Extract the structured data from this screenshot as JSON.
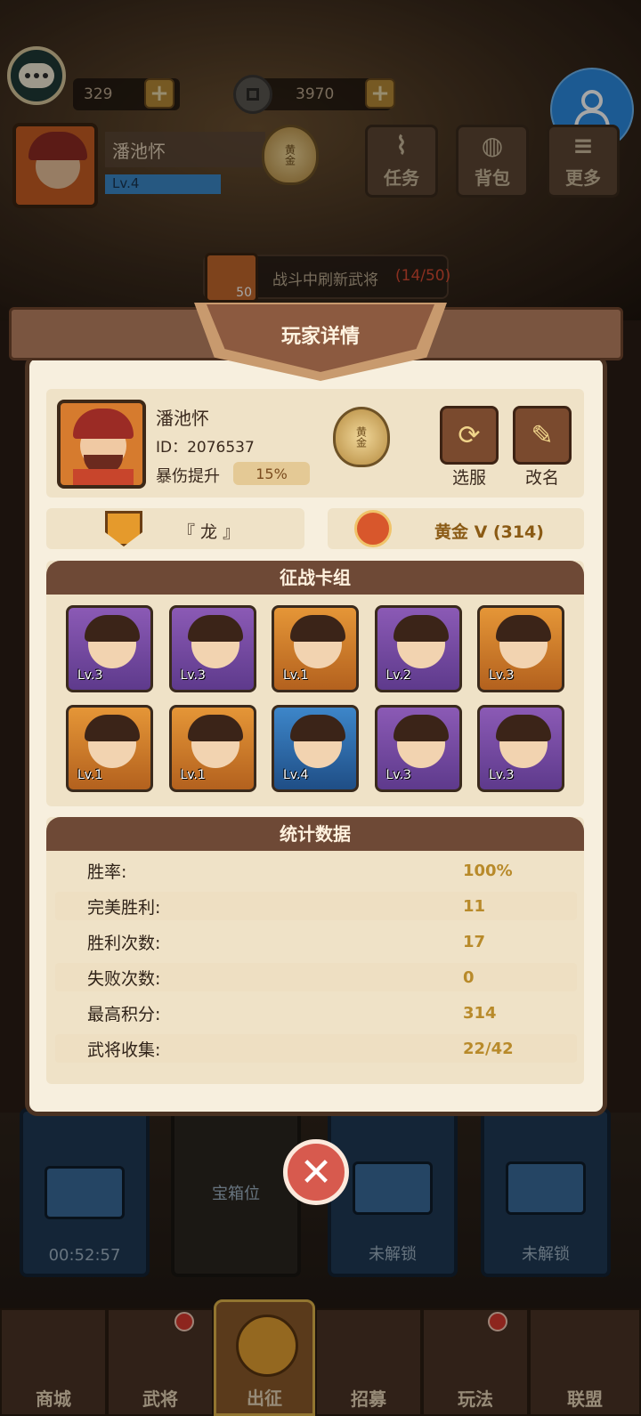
{
  "topbar": {
    "gem_amount": "329",
    "coin_amount": "3970",
    "player_name": "潘池怀",
    "player_level": "Lv.4",
    "rank_badge": "黄金",
    "buttons": [
      {
        "label": "任务",
        "icon": "scroll-icon"
      },
      {
        "label": "背包",
        "icon": "bag-icon"
      },
      {
        "label": "更多",
        "icon": "menu-icon"
      }
    ],
    "refresh_reward": "50",
    "refresh_text": "战斗中刷新武将",
    "refresh_progress": "(14/50)"
  },
  "dialog": {
    "title": "玩家详情",
    "name": "潘池怀",
    "id_label": "ID：2076537",
    "crit_label": "暴伤提升",
    "crit_value": "15%",
    "medal_text": "黄金",
    "switch_server": "选服",
    "rename": "改名",
    "guild": "『 龙 』",
    "rank": "黄金 V (314)",
    "deck_title": "征战卡组",
    "deck": [
      {
        "lv": "Lv.3",
        "rarity": "purple"
      },
      {
        "lv": "Lv.3",
        "rarity": "purple"
      },
      {
        "lv": "Lv.1",
        "rarity": "orange"
      },
      {
        "lv": "Lv.2",
        "rarity": "purple"
      },
      {
        "lv": "Lv.3",
        "rarity": "orange"
      },
      {
        "lv": "Lv.1",
        "rarity": "orange"
      },
      {
        "lv": "Lv.1",
        "rarity": "orange"
      },
      {
        "lv": "Lv.4",
        "rarity": "blue"
      },
      {
        "lv": "Lv.3",
        "rarity": "purple"
      },
      {
        "lv": "Lv.3",
        "rarity": "purple"
      }
    ],
    "stats_title": "统计数据",
    "stats": [
      {
        "k": "胜率:",
        "v": "100%"
      },
      {
        "k": "完美胜利:",
        "v": "11"
      },
      {
        "k": "胜利次数:",
        "v": "17"
      },
      {
        "k": "失败次数:",
        "v": "0"
      },
      {
        "k": "最高积分:",
        "v": "314"
      },
      {
        "k": "武将收集:",
        "v": "22/42"
      }
    ]
  },
  "chests": [
    {
      "status": "00:52:57"
    },
    {
      "status": "宝箱位"
    },
    {
      "status": "未解锁"
    },
    {
      "status": "未解锁"
    }
  ],
  "nav": {
    "tabs": [
      "商城",
      "武将",
      "出征",
      "招募",
      "玩法",
      "联盟"
    ]
  },
  "colors": {
    "panel_bg": "#f7efde",
    "header_brown": "#6e4936",
    "gold_text": "#b88a2a",
    "close_red": "#d75a4e",
    "profile_blue": "#2b8be0"
  }
}
